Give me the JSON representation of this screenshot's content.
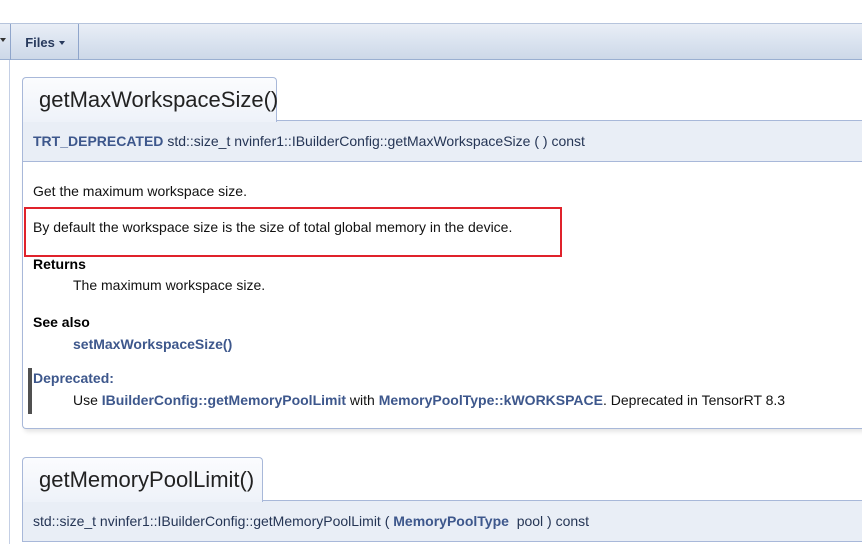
{
  "tabbar": {
    "files_label": "Files"
  },
  "members": [
    {
      "title": "getMaxWorkspaceSize()",
      "proto_macro": "TRT_DEPRECATED",
      "proto_text": "std::size_t nvinfer1::IBuilderConfig::getMaxWorkspaceSize (  ) const",
      "brief": "Get the maximum workspace size.",
      "detail": "By default the workspace size is the size of total global memory in the device.",
      "returns_heading": "Returns",
      "returns_text": "The maximum workspace size.",
      "see_also_heading": "See also",
      "see_also_link": "setMaxWorkspaceSize()",
      "deprecated_heading": "Deprecated:",
      "deprecated_prefix": "Use ",
      "deprecated_link1": "IBuilderConfig::getMemoryPoolLimit",
      "deprecated_mid": " with ",
      "deprecated_link2": "MemoryPoolType::kWORKSPACE",
      "deprecated_suffix": ". Deprecated in TensorRT 8.3"
    },
    {
      "title": "getMemoryPoolLimit()",
      "proto_prefix": "std::size_t nvinfer1::IBuilderConfig::getMemoryPoolLimit ( ",
      "proto_type": "MemoryPoolType",
      "proto_suffix": "  pool ) const"
    }
  ],
  "colors": {
    "link": "#3d578c",
    "highlight_box": "#e0222b",
    "proto_bg": "#e9eef6",
    "border": "#a8b8d9"
  },
  "icons": [
    "chevron-down-icon",
    "diamond-icon"
  ]
}
